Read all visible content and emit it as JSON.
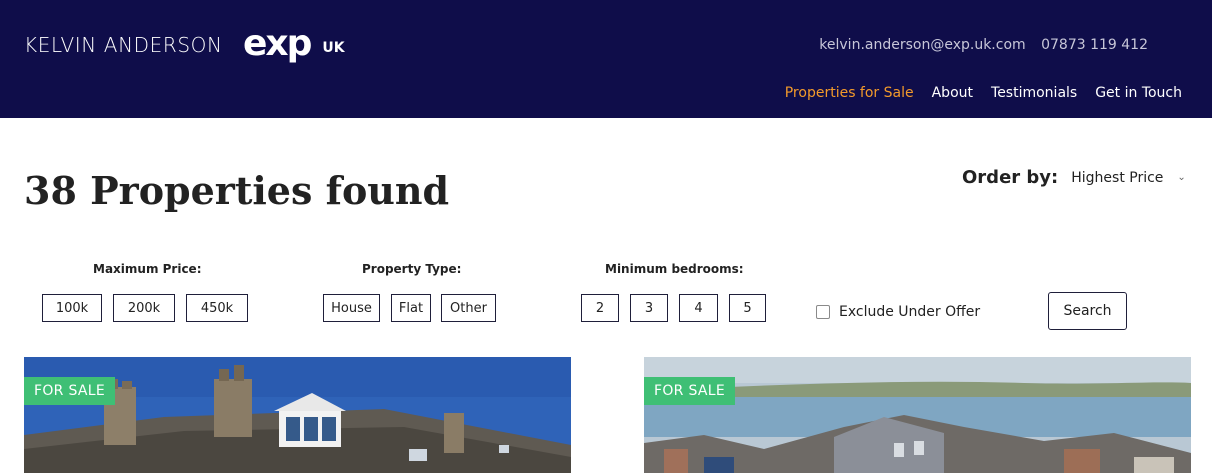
{
  "header": {
    "brand_name": "KELVIN ANDERSON",
    "logo_text": "exp",
    "logo_region": "UK",
    "email": "kelvin.anderson@exp.uk.com",
    "phone": "07873 119 412",
    "nav": [
      {
        "label": "Properties for Sale",
        "active": true
      },
      {
        "label": "About",
        "active": false
      },
      {
        "label": "Testimonials",
        "active": false
      },
      {
        "label": "Get in Touch",
        "active": false
      }
    ]
  },
  "main": {
    "title": "38 Properties found",
    "order_by": {
      "label": "Order by:",
      "value": "Highest Price"
    }
  },
  "filters": {
    "max_price": {
      "label": "Maximum Price:",
      "options": [
        "100k",
        "200k",
        "450k"
      ]
    },
    "property_type": {
      "label": "Property Type:",
      "options": [
        "House",
        "Flat",
        "Other"
      ]
    },
    "min_bedrooms": {
      "label": "Minimum bedrooms:",
      "options": [
        "2",
        "3",
        "4",
        "5"
      ]
    },
    "exclude_under_offer": {
      "label": "Exclude Under Offer",
      "checked": false
    },
    "search_label": "Search"
  },
  "listings": [
    {
      "badge": "FOR SALE"
    },
    {
      "badge": "FOR SALE"
    }
  ],
  "colors": {
    "header_bg": "#0f0d4a",
    "nav_active": "#f39a2b",
    "badge_bg": "#3fbf75"
  }
}
